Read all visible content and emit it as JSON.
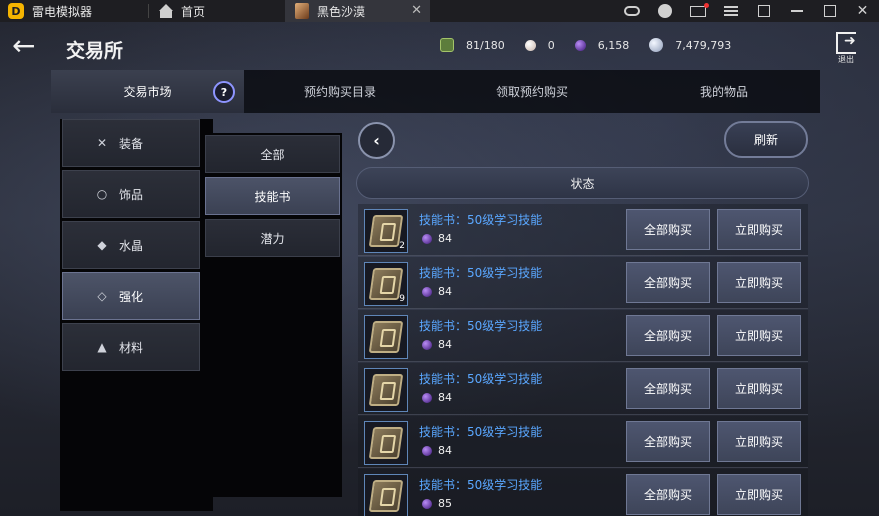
{
  "emulator": {
    "app_name": "雷电模拟器",
    "home_tab": "首页",
    "game_tab": "黑色沙漠"
  },
  "page": {
    "title": "交易所",
    "exit_label": "退出"
  },
  "resources": {
    "bag": "81/180",
    "pearl": "0",
    "dark_gem": "6,158",
    "silver": "7,479,793"
  },
  "tabs": [
    {
      "label": "交易市场"
    },
    {
      "label": "预约购买目录"
    },
    {
      "label": "领取预约购买"
    },
    {
      "label": "我的物品"
    }
  ],
  "categories": [
    {
      "label": "装备",
      "icon": "crossed-swords-icon"
    },
    {
      "label": "饰品",
      "icon": "ring-icon"
    },
    {
      "label": "水晶",
      "icon": "crystal-icon"
    },
    {
      "label": "强化",
      "icon": "enhance-icon"
    },
    {
      "label": "材料",
      "icon": "potion-icon"
    }
  ],
  "subcategories": [
    {
      "label": "全部"
    },
    {
      "label": "技能书"
    },
    {
      "label": "潜力"
    }
  ],
  "listing": {
    "refresh_label": "刷新",
    "status_header": "状态",
    "buy_all_label": "全部购买",
    "buy_now_label": "立即购买",
    "items": [
      {
        "name": "技能书：50级学习技能",
        "qty": "2",
        "price": "84"
      },
      {
        "name": "技能书：50级学习技能",
        "qty": "9",
        "price": "84"
      },
      {
        "name": "技能书：50级学习技能",
        "qty": "",
        "price": "84"
      },
      {
        "name": "技能书：50级学习技能",
        "qty": "",
        "price": "84"
      },
      {
        "name": "技能书：50级学习技能",
        "qty": "",
        "price": "84"
      },
      {
        "name": "技能书：50级学习技能",
        "qty": "",
        "price": "85"
      }
    ]
  }
}
